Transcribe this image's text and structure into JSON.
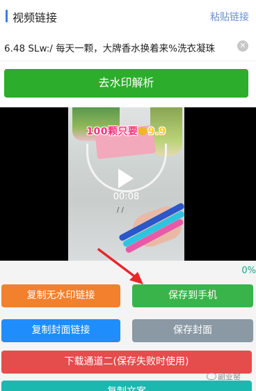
{
  "header": {
    "title": "视频链接",
    "paste_label": "粘贴链接"
  },
  "input": {
    "value": "6.48 SLw:/ 每天一颗，大牌香水换着来%洗衣凝珠"
  },
  "parse_button": {
    "label": "去水印解析"
  },
  "video": {
    "caption_prefix": "100颗只要",
    "caption_price": "9.9",
    "timer": "00:08",
    "scribble": "/ /"
  },
  "progress": {
    "percent_label": "0%",
    "value": 0
  },
  "actions": {
    "copy_no_watermark": "复制无水印链接",
    "save_to_phone": "保存到手机",
    "copy_cover_link": "复制封面链接",
    "save_cover": "保存封面",
    "download_channel_two": "下载通道二(保存失败时使用)",
    "copy_text": "复制文案"
  },
  "watermark": {
    "text": "副业窑"
  },
  "colors": {
    "primary_green": "#2cad2c",
    "accent_blue": "#3b7bea",
    "orange": "#f3802d",
    "green": "#39b44a",
    "blue": "#1f8dfb",
    "gray": "#8a99a4",
    "red": "#e54c4c",
    "teal": "#1bb8b0",
    "arrow_red": "#e8262a"
  }
}
